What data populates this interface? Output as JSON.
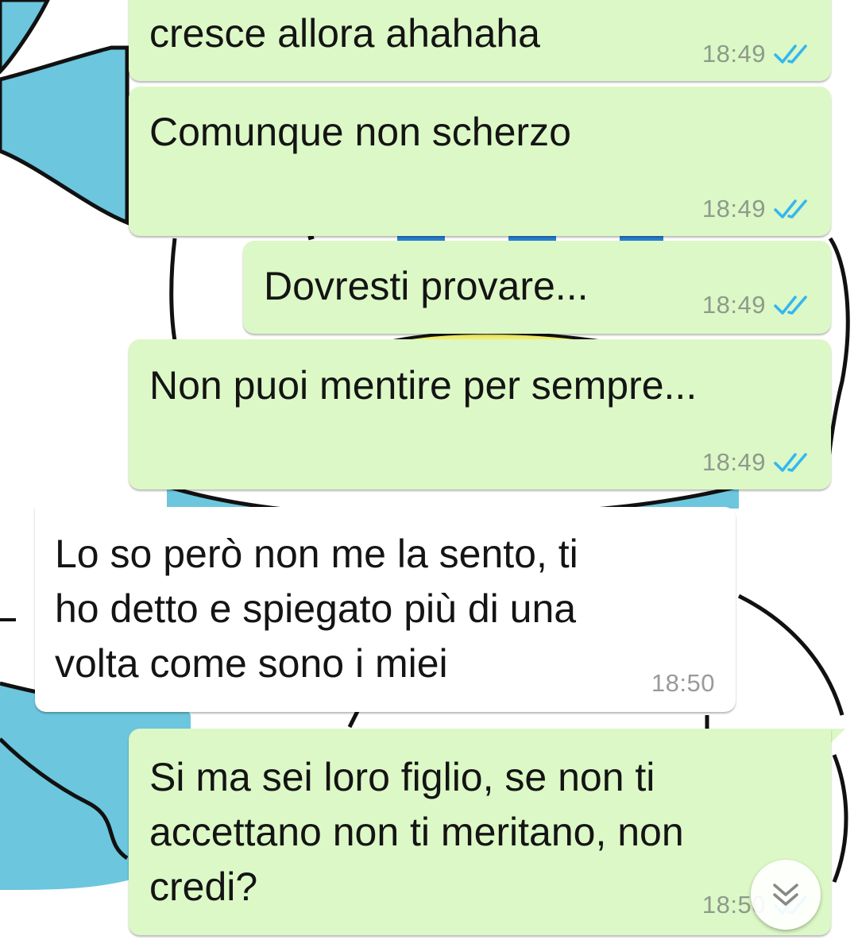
{
  "chat": {
    "colors": {
      "outgoing_bubble": "#dcf8c6",
      "incoming_bubble": "#ffffff",
      "read_ticks": "#34b7f1",
      "timestamp": "#8e9a8c"
    },
    "messages": [
      {
        "direction": "outgoing",
        "lines": [
          "cresce allora ahahaha"
        ],
        "time": "18:49",
        "status": "read",
        "status_icon": "double-check-icon"
      },
      {
        "direction": "outgoing",
        "lines": [
          "Comunque non scherzo"
        ],
        "time": "18:49",
        "status": "read",
        "status_icon": "double-check-icon"
      },
      {
        "direction": "outgoing",
        "lines": [
          "Dovresti provare..."
        ],
        "time": "18:49",
        "status": "read",
        "status_icon": "double-check-icon"
      },
      {
        "direction": "outgoing",
        "lines": [
          "Non puoi mentire per sempre..."
        ],
        "time": "18:49",
        "status": "read",
        "status_icon": "double-check-icon"
      },
      {
        "direction": "incoming",
        "lines": [
          "Lo so però non me la sento, ti",
          "ho detto e spiegato più di una",
          "volta come sono i miei"
        ],
        "time": "18:50"
      },
      {
        "direction": "outgoing",
        "lines": [
          "Si ma sei loro figlio, se non ti",
          "accettano non ti meritano, non",
          "credi?"
        ],
        "time": "18:50",
        "status": "read",
        "status_icon": "double-check-icon"
      }
    ],
    "scroll_to_bottom": {
      "icon": "double-chevron-down-icon"
    }
  }
}
